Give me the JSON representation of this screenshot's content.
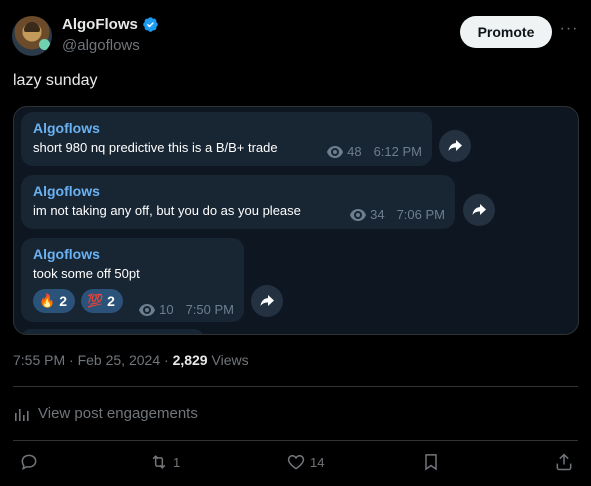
{
  "author": {
    "name": "AlgoFlows",
    "handle": "@algoflows",
    "verified_color": "#1d9bf0"
  },
  "header": {
    "promote_label": "Promote",
    "more_icon": "more-dots-icon"
  },
  "post": {
    "text": "lazy sunday"
  },
  "embed": {
    "messages": [
      {
        "sender": "Algoflows",
        "text": "short 980 nq predictive this is a B/B+ trade",
        "views": "48",
        "time": "6:12 PM"
      },
      {
        "sender": "Algoflows",
        "text": "im not taking any off, but you do as you please",
        "views": "34",
        "time": "7:06 PM"
      },
      {
        "sender": "Algoflows",
        "text": "took some off 50pt",
        "views": "10",
        "time": "7:50 PM",
        "reactions": [
          {
            "emoji": "🔥",
            "count": "2"
          },
          {
            "emoji": "💯",
            "count": "2"
          }
        ]
      }
    ],
    "bubble_color": "#182533",
    "sender_color": "#6ab2f2"
  },
  "meta": {
    "time": "7:55 PM",
    "sep1": "·",
    "date": "Feb 25, 2024",
    "sep2": "·",
    "views_count": "2,829",
    "views_label": "Views"
  },
  "engagements": {
    "label": "View post engagements"
  },
  "actions": {
    "reply_count": "",
    "repost_count": "1",
    "like_count": "14"
  }
}
